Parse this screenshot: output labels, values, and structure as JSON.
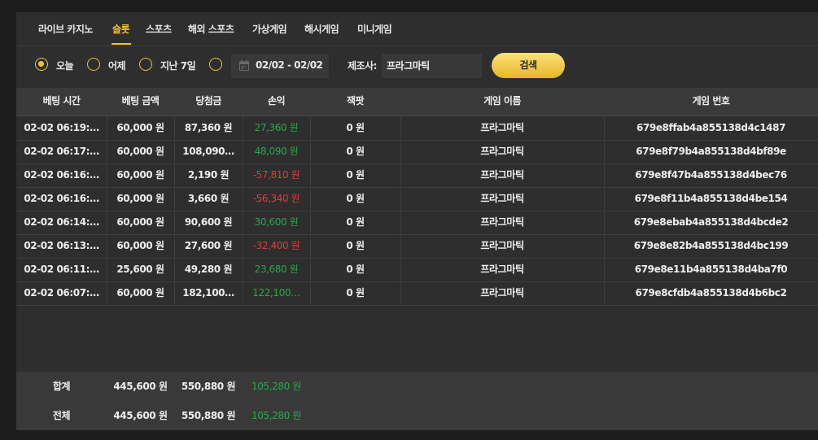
{
  "tabs": [
    {
      "label": "라이브 카지노",
      "active": false
    },
    {
      "label": "슬롯",
      "active": true
    },
    {
      "label": "스포츠",
      "active": false
    },
    {
      "label": "해외 스포츠",
      "active": false
    },
    {
      "label": "가상게임",
      "active": false
    },
    {
      "label": "해시게임",
      "active": false
    },
    {
      "label": "미니게임",
      "active": false
    }
  ],
  "filters": {
    "periods": [
      {
        "label": "오늘",
        "checked": true
      },
      {
        "label": "어제",
        "checked": false
      },
      {
        "label": "지난 7일",
        "checked": false
      },
      {
        "label": "",
        "checked": false
      }
    ],
    "calendar_icon": "calendar-icon",
    "date_range": "02/02 - 02/02",
    "maker_label": "제조사:",
    "maker_value": "프라그마틱",
    "search_label": "검색"
  },
  "colors": {
    "accent": "#f2c230",
    "positive": "#27a84a",
    "negative": "#e03b3b"
  },
  "table": {
    "headers": [
      "베팅 시간",
      "베팅 금액",
      "당첨금",
      "손익",
      "잭팟",
      "게임 이름",
      "게임 번호"
    ],
    "rows": [
      {
        "time": "02-02 06:19:…",
        "bet": "60,000 원",
        "win": "87,360 원",
        "profit": "27,360 원",
        "sign": "pos",
        "jackpot": "0 원",
        "game": "프라그마틱",
        "game_id": "679e8ffab4a855138d4c1487"
      },
      {
        "time": "02-02 06:17:…",
        "bet": "60,000 원",
        "win": "108,090…",
        "profit": "48,090 원",
        "sign": "pos",
        "jackpot": "0 원",
        "game": "프라그마틱",
        "game_id": "679e8f79b4a855138d4bf89e"
      },
      {
        "time": "02-02 06:16:…",
        "bet": "60,000 원",
        "win": "2,190 원",
        "profit": "-57,810 원",
        "sign": "neg",
        "jackpot": "0 원",
        "game": "프라그마틱",
        "game_id": "679e8f47b4a855138d4bec76"
      },
      {
        "time": "02-02 06:16:…",
        "bet": "60,000 원",
        "win": "3,660 원",
        "profit": "-56,340 원",
        "sign": "neg",
        "jackpot": "0 원",
        "game": "프라그마틱",
        "game_id": "679e8f11b4a855138d4be154"
      },
      {
        "time": "02-02 06:14:…",
        "bet": "60,000 원",
        "win": "90,600 원",
        "profit": "30,600 원",
        "sign": "pos",
        "jackpot": "0 원",
        "game": "프라그마틱",
        "game_id": "679e8ebab4a855138d4bcde2"
      },
      {
        "time": "02-02 06:13:…",
        "bet": "60,000 원",
        "win": "27,600 원",
        "profit": "-32,400 원",
        "sign": "neg",
        "jackpot": "0 원",
        "game": "프라그마틱",
        "game_id": "679e8e82b4a855138d4bc199"
      },
      {
        "time": "02-02 06:11:…",
        "bet": "25,600 원",
        "win": "49,280 원",
        "profit": "23,680 원",
        "sign": "pos",
        "jackpot": "0 원",
        "game": "프라그마틱",
        "game_id": "679e8e11b4a855138d4ba7f0"
      },
      {
        "time": "02-02 06:07:…",
        "bet": "60,000 원",
        "win": "182,100…",
        "profit": "122,100…",
        "sign": "pos",
        "jackpot": "0 원",
        "game": "프라그마틱",
        "game_id": "679e8cfdb4a855138d4b6bc2"
      }
    ]
  },
  "footer": [
    {
      "label": "합계",
      "bet": "445,600 원",
      "win": "550,880 원",
      "profit": "105,280 원"
    },
    {
      "label": "전체",
      "bet": "445,600 원",
      "win": "550,880 원",
      "profit": "105,280 원"
    }
  ]
}
